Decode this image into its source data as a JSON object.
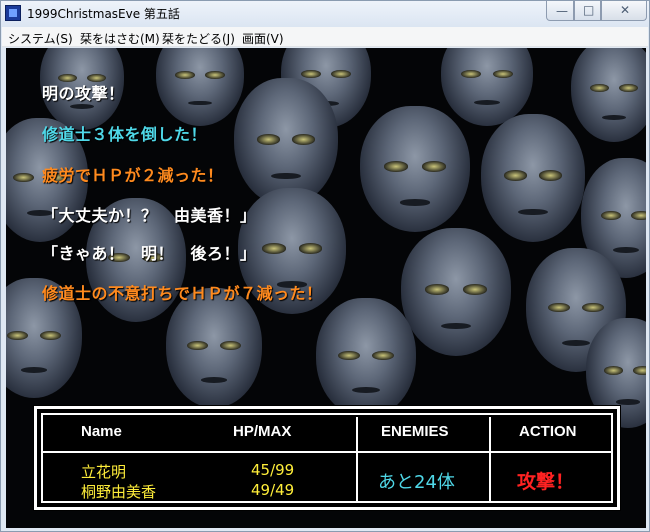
{
  "window": {
    "title": "1999ChristmasEve 第五話"
  },
  "menu": [
    {
      "label": "システム(S)"
    },
    {
      "label": "栞をはさむ(M)"
    },
    {
      "label": "栞をたどる(J)"
    },
    {
      "label": "画面(V)"
    }
  ],
  "messages": [
    {
      "text": "明の攻撃！",
      "color": "#ffffff"
    },
    {
      "text": "修道士３体を倒した！",
      "color": "#4fd8e8"
    },
    {
      "text": "疲労でＨＰが２減った！",
      "color": "#ff8a1e"
    },
    {
      "text": "「大丈夫か！？　由美香！」",
      "color": "#ffffff"
    },
    {
      "text": "「きゃあ！　明！　後ろ！」",
      "color": "#ffffff"
    },
    {
      "text": "修道士の不意打ちでＨＰが７減った！",
      "color": "#ff8a1e"
    }
  ],
  "status": {
    "headers": {
      "name": "Name",
      "hp": "HP/MAX",
      "enemies": "ENEMIES",
      "action": "ACTION"
    },
    "party": [
      {
        "name": "立花明",
        "hp": "45/99"
      },
      {
        "name": "桐野由美香",
        "hp": "49/49"
      }
    ],
    "enemies_text": "あと24体",
    "action_text": "攻撃！",
    "colors": {
      "party": "#ffee3a",
      "enemies": "#4fd8e8",
      "action": "#ff2222"
    }
  }
}
